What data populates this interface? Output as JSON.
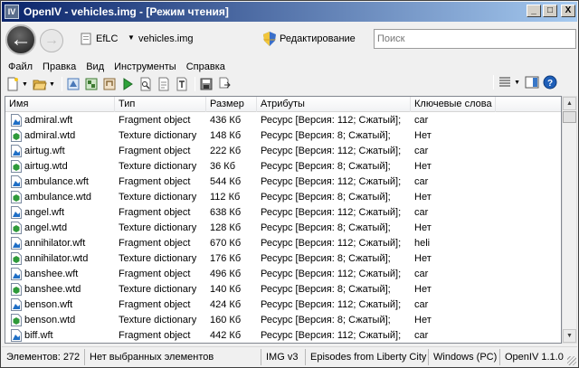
{
  "window": {
    "title": "OpenIV - vehicles.img - [Режим чтения]",
    "buttons": {
      "minimize": "_",
      "maximize": "□",
      "close": "X"
    }
  },
  "nav": {
    "breadcrumb_root": "EfLC",
    "breadcrumb_file": "vehicles.img",
    "edit_label": "Редактирование",
    "search_placeholder": "Поиск"
  },
  "menu": [
    "Файл",
    "Правка",
    "Вид",
    "Инструменты",
    "Справка"
  ],
  "columns": [
    "Имя",
    "Тип",
    "Размер",
    "Атрибуты",
    "Ключевые слова"
  ],
  "rows": [
    {
      "name": "admiral.wft",
      "type": "Fragment object",
      "size": "436 Кб",
      "attr": "Ресурс [Версия: 112; Сжатый];",
      "kw": "car",
      "icon": "wft"
    },
    {
      "name": "admiral.wtd",
      "type": "Texture dictionary",
      "size": "148 Кб",
      "attr": "Ресурс [Версия: 8; Сжатый];",
      "kw": "Нет",
      "icon": "wtd"
    },
    {
      "name": "airtug.wft",
      "type": "Fragment object",
      "size": "222 Кб",
      "attr": "Ресурс [Версия: 112; Сжатый];",
      "kw": "car",
      "icon": "wft"
    },
    {
      "name": "airtug.wtd",
      "type": "Texture dictionary",
      "size": "36 Кб",
      "attr": "Ресурс [Версия: 8; Сжатый];",
      "kw": "Нет",
      "icon": "wtd"
    },
    {
      "name": "ambulance.wft",
      "type": "Fragment object",
      "size": "544 Кб",
      "attr": "Ресурс [Версия: 112; Сжатый];",
      "kw": "car",
      "icon": "wft"
    },
    {
      "name": "ambulance.wtd",
      "type": "Texture dictionary",
      "size": "112 Кб",
      "attr": "Ресурс [Версия: 8; Сжатый];",
      "kw": "Нет",
      "icon": "wtd"
    },
    {
      "name": "angel.wft",
      "type": "Fragment object",
      "size": "638 Кб",
      "attr": "Ресурс [Версия: 112; Сжатый];",
      "kw": "car",
      "icon": "wft"
    },
    {
      "name": "angel.wtd",
      "type": "Texture dictionary",
      "size": "128 Кб",
      "attr": "Ресурс [Версия: 8; Сжатый];",
      "kw": "Нет",
      "icon": "wtd"
    },
    {
      "name": "annihilator.wft",
      "type": "Fragment object",
      "size": "670 Кб",
      "attr": "Ресурс [Версия: 112; Сжатый];",
      "kw": "heli",
      "icon": "wft"
    },
    {
      "name": "annihilator.wtd",
      "type": "Texture dictionary",
      "size": "176 Кб",
      "attr": "Ресурс [Версия: 8; Сжатый];",
      "kw": "Нет",
      "icon": "wtd"
    },
    {
      "name": "banshee.wft",
      "type": "Fragment object",
      "size": "496 Кб",
      "attr": "Ресурс [Версия: 112; Сжатый];",
      "kw": "car",
      "icon": "wft"
    },
    {
      "name": "banshee.wtd",
      "type": "Texture dictionary",
      "size": "140 Кб",
      "attr": "Ресурс [Версия: 8; Сжатый];",
      "kw": "Нет",
      "icon": "wtd"
    },
    {
      "name": "benson.wft",
      "type": "Fragment object",
      "size": "424 Кб",
      "attr": "Ресурс [Версия: 112; Сжатый];",
      "kw": "car",
      "icon": "wft"
    },
    {
      "name": "benson.wtd",
      "type": "Texture dictionary",
      "size": "160 Кб",
      "attr": "Ресурс [Версия: 8; Сжатый];",
      "kw": "Нет",
      "icon": "wtd"
    },
    {
      "name": "biff.wft",
      "type": "Fragment object",
      "size": "442 Кб",
      "attr": "Ресурс [Версия: 112; Сжатый];",
      "kw": "car",
      "icon": "wft"
    }
  ],
  "status": {
    "count": "Элементов: 272",
    "selection": "Нет выбранных элементов",
    "format": "IMG v3",
    "game": "Episodes from Liberty City",
    "platform": "Windows (PC)",
    "version": "OpenIV 1.1.0"
  },
  "colors": {
    "title_start": "#0a246a",
    "title_end": "#a6caf0",
    "wft_icon": "#1f6fc6",
    "wtd_icon": "#2e9a3a"
  }
}
